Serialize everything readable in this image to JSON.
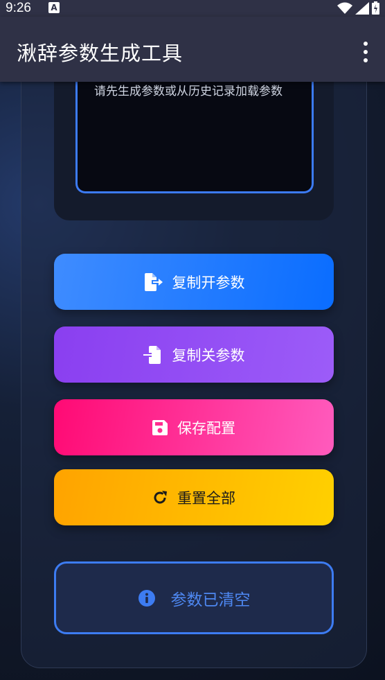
{
  "status_bar": {
    "time": "9:26",
    "notification_icon": "A"
  },
  "app_bar": {
    "title": "湫辞参数生成工具",
    "menu_icon": "more-vert-icon"
  },
  "output": {
    "placeholder_text": "请先生成参数或从历史记录加载参数"
  },
  "buttons": {
    "copy_open": {
      "label": "复制开参数",
      "icon": "file-export-icon",
      "color": "#1a75ff"
    },
    "copy_close": {
      "label": "复制关参数",
      "icon": "file-import-icon",
      "color": "#9150f4"
    },
    "save_config": {
      "label": "保存配置",
      "icon": "save-icon",
      "color": "#ff2d8f"
    },
    "reset_all": {
      "label": "重置全部",
      "icon": "redo-icon",
      "color": "#ffb800"
    }
  },
  "status_message": {
    "text": "参数已清空",
    "icon": "info-icon",
    "color": "#3d7cf2"
  }
}
